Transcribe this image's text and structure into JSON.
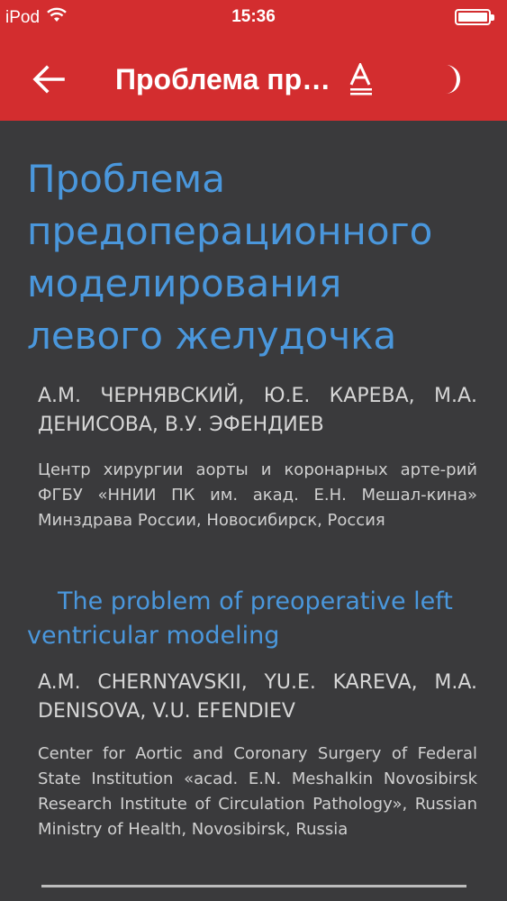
{
  "status_bar": {
    "carrier": "iPod",
    "time": "15:36",
    "battery_level": 1.0
  },
  "toolbar": {
    "title": "Проблема предоперационного моделирования левого желудочка",
    "back_icon": "arrow-left-icon",
    "font_icon": "font-size-icon",
    "night_icon": "moon-icon",
    "background_color": "#d32d2f"
  },
  "article": {
    "title_ru": "Проблема предоперационного моделирования левого желудочка",
    "authors_ru": "А.М. ЧЕРНЯВСКИЙ, Ю.Е. КАРЕВА, М.А. ДЕНИСОВА, В.У. ЭФЕНДИЕВ",
    "affiliation_ru": "Центр хирургии аорты и коронарных арте-рий ФГБУ «ННИИ ПК им. акад. Е.Н. Мешал-кина» Минздрава России, Новосибирск, Россия",
    "title_en": "The problem of preoperative left ventricular modeling",
    "authors_en": "A.M. CHERNYAVSKII, YU.E. KAREVA, M.A. DENISOVA, V.U. EFENDIEV",
    "affiliation_en": "Center for Aortic and Coronary Surgery of Federal State Institution «acad. E.N. Meshalkin Novosibirsk Research Institute of Circulation Pathology», Russian Ministry of Health, Novosibirsk, Russia",
    "title_color": "#4a97dc",
    "background_color": "#3a3a3c"
  }
}
